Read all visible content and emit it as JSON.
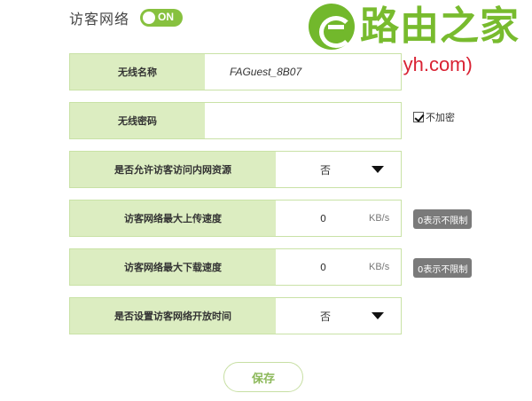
{
  "header": {
    "title": "访客网络",
    "toggle_label": "ON"
  },
  "watermark": {
    "name": "路由之家",
    "url": "(www.hhhyh.com)"
  },
  "ssid": {
    "label": "无线名称",
    "value": "FAGuest_8B07"
  },
  "password": {
    "label": "无线密码",
    "value": "",
    "no_encrypt_label": "不加密",
    "no_encrypt_checked": true
  },
  "intranet_access": {
    "label": "是否允许访客访问内网资源",
    "selected": "否"
  },
  "upload_speed": {
    "label": "访客网络最大上传速度",
    "value": "0",
    "unit": "KB/s",
    "hint": "0表示不限制"
  },
  "download_speed": {
    "label": "访客网络最大下载速度",
    "value": "0",
    "unit": "KB/s",
    "hint": "0表示不限制"
  },
  "open_time": {
    "label": "是否设置访客网络开放时间",
    "selected": "否"
  },
  "save_label": "保存"
}
